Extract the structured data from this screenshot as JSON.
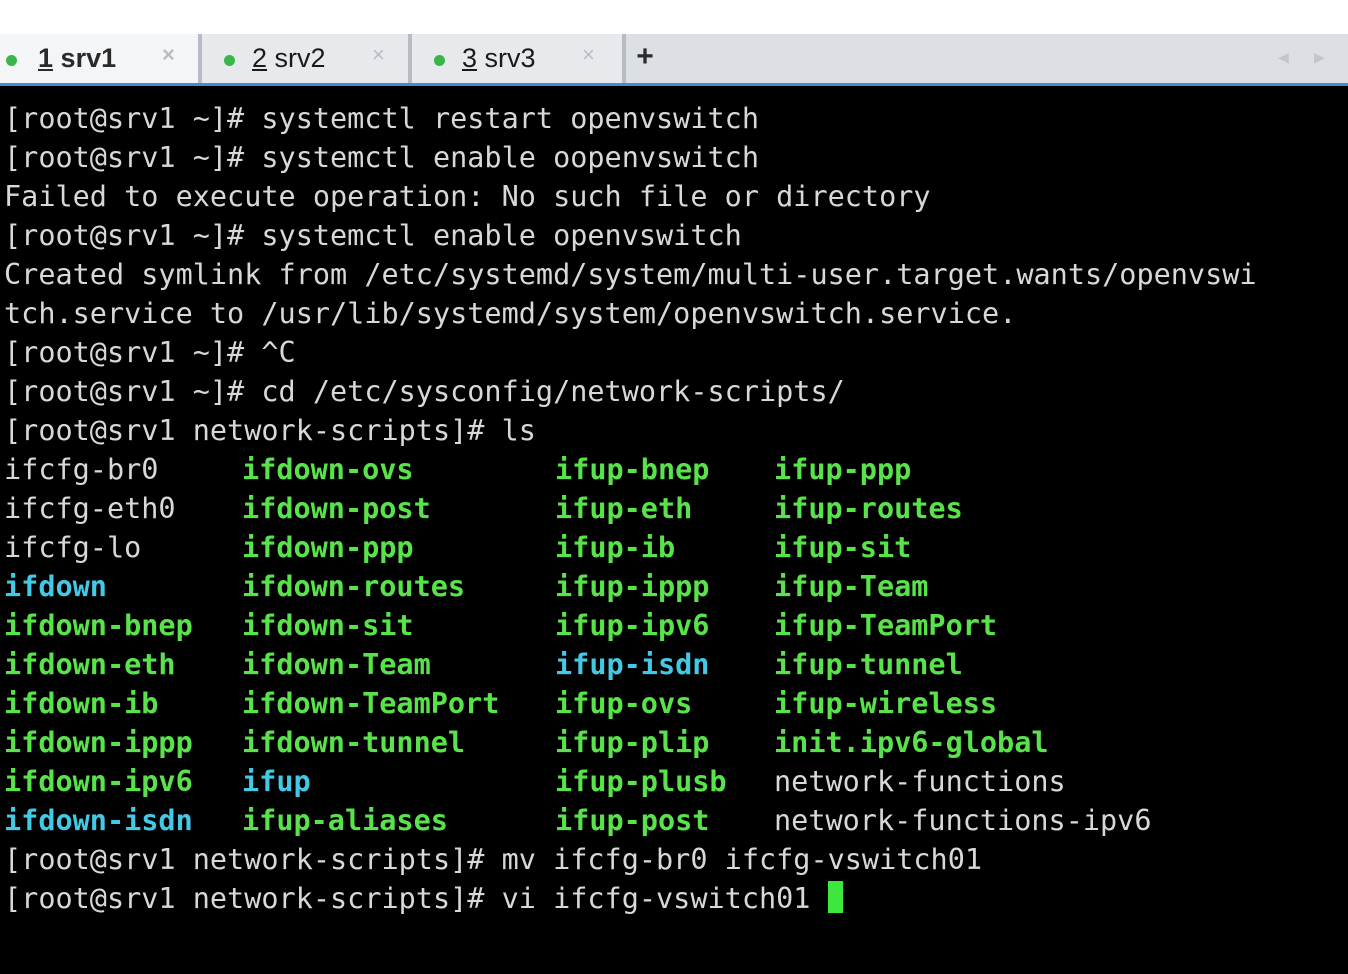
{
  "tabs": [
    {
      "number": "1",
      "name": "srv1",
      "active": true,
      "dot_color": "#39b54a",
      "close": "×"
    },
    {
      "number": "2",
      "name": "srv2",
      "active": false,
      "dot_color": "#39b54a",
      "close": "×"
    },
    {
      "number": "3",
      "name": "srv3",
      "active": false,
      "dot_color": "#39b54a",
      "close": "×"
    }
  ],
  "tabbar": {
    "new_tab": "+",
    "scroll_left": "◀",
    "scroll_right": "▶"
  },
  "terminal": {
    "lines": [
      "[root@srv1 ~]# systemctl restart openvswitch",
      "[root@srv1 ~]# systemctl enable oopenvswitch",
      "Failed to execute operation: No such file or directory",
      "[root@srv1 ~]# systemctl enable openvswitch",
      "Created symlink from /etc/systemd/system/multi-user.target.wants/openvswi",
      "tch.service to /usr/lib/systemd/system/openvswitch.service.",
      "[root@srv1 ~]# ^C",
      "[root@srv1 ~]# cd /etc/sysconfig/network-scripts/",
      "[root@srv1 network-scripts]# ls"
    ],
    "ls_rows": [
      [
        [
          "ifcfg-br0",
          "plain"
        ],
        [
          "ifdown-ovs",
          "exec"
        ],
        [
          "ifup-bnep",
          "exec"
        ],
        [
          "ifup-ppp",
          "exec"
        ]
      ],
      [
        [
          "ifcfg-eth0",
          "plain"
        ],
        [
          "ifdown-post",
          "exec"
        ],
        [
          "ifup-eth",
          "exec"
        ],
        [
          "ifup-routes",
          "exec"
        ]
      ],
      [
        [
          "ifcfg-lo",
          "plain"
        ],
        [
          "ifdown-ppp",
          "exec"
        ],
        [
          "ifup-ib",
          "exec"
        ],
        [
          "ifup-sit",
          "exec"
        ]
      ],
      [
        [
          "ifdown",
          "link"
        ],
        [
          "ifdown-routes",
          "exec"
        ],
        [
          "ifup-ippp",
          "exec"
        ],
        [
          "ifup-Team",
          "exec"
        ]
      ],
      [
        [
          "ifdown-bnep",
          "exec"
        ],
        [
          "ifdown-sit",
          "exec"
        ],
        [
          "ifup-ipv6",
          "exec"
        ],
        [
          "ifup-TeamPort",
          "exec"
        ]
      ],
      [
        [
          "ifdown-eth",
          "exec"
        ],
        [
          "ifdown-Team",
          "exec"
        ],
        [
          "ifup-isdn",
          "link"
        ],
        [
          "ifup-tunnel",
          "exec"
        ]
      ],
      [
        [
          "ifdown-ib",
          "exec"
        ],
        [
          "ifdown-TeamPort",
          "exec"
        ],
        [
          "ifup-ovs",
          "exec"
        ],
        [
          "ifup-wireless",
          "exec"
        ]
      ],
      [
        [
          "ifdown-ippp",
          "exec"
        ],
        [
          "ifdown-tunnel",
          "exec"
        ],
        [
          "ifup-plip",
          "exec"
        ],
        [
          "init.ipv6-global",
          "exec"
        ]
      ],
      [
        [
          "ifdown-ipv6",
          "exec"
        ],
        [
          "ifup",
          "link"
        ],
        [
          "ifup-plusb",
          "exec"
        ],
        [
          "network-functions",
          "plain"
        ]
      ],
      [
        [
          "ifdown-isdn",
          "link"
        ],
        [
          "ifup-aliases",
          "exec"
        ],
        [
          "ifup-post",
          "exec"
        ],
        [
          "network-functions-ipv6",
          "plain"
        ]
      ]
    ],
    "after_lines": [
      "[root@srv1 network-scripts]# mv ifcfg-br0 ifcfg-vswitch01",
      "[root@srv1 network-scripts]# vi ifcfg-vswitch01 "
    ],
    "colors": {
      "background": "#000000",
      "text": "#d8d8d8",
      "executable": "#59e34a",
      "symlink": "#43c9e6",
      "cursor": "#3ce63c",
      "tab_accent": "#4a88d6"
    }
  }
}
